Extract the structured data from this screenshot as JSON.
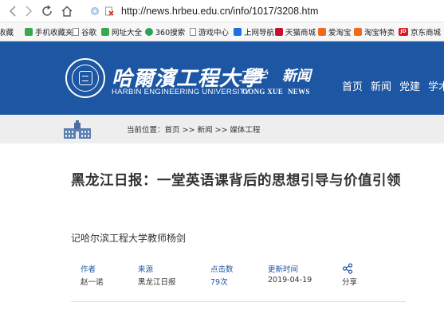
{
  "browser": {
    "url": "http://news.hrbeu.edu.cn/info/1017/3208.htm",
    "bookmarks": [
      {
        "label": "收藏",
        "icon": "none"
      },
      {
        "label": "手机收藏夹",
        "icon": "mobile-icon"
      },
      {
        "label": "谷歌",
        "icon": "page-icon"
      },
      {
        "label": "网址大全",
        "icon": "site-icon"
      },
      {
        "label": "360搜索",
        "icon": "search-360-icon"
      },
      {
        "label": "游戏中心",
        "icon": "page-icon"
      },
      {
        "label": "上网导航",
        "icon": "nav-icon"
      },
      {
        "label": "天猫商城",
        "icon": "tmall-icon"
      },
      {
        "label": "爱淘宝",
        "icon": "taobao-icon"
      },
      {
        "label": "淘宝特卖",
        "icon": "taobao-icon"
      },
      {
        "label": "京东商城",
        "icon": "jd-icon"
      }
    ]
  },
  "header": {
    "university_cn": "哈爾濱工程大學",
    "university_en": "HARBIN ENGINEERING UNIVERSITY",
    "brand_cn": "工学",
    "brand_news": "新闻",
    "brand_en_1": "GONG XUE",
    "brand_en_2": "NEWS",
    "nav": [
      "首页",
      "新闻",
      "党建",
      "学术"
    ]
  },
  "breadcrumb": {
    "label": "当前位置：",
    "path": "首页 >> 新闻 >> 媒体工程"
  },
  "article": {
    "title": "黑龙江日报：一堂英语课背后的思想引导与价值引领",
    "subtitle": "记哈尔滨工程大学教师杨剑",
    "meta": {
      "author_label": "作者",
      "author": "赵一诺",
      "source_label": "来源",
      "source": "黑龙江日报",
      "clicks_label": "点击数",
      "clicks": "79次",
      "updated_label": "更新时间",
      "updated": "2019-04-19",
      "share_label": "分享"
    }
  },
  "colors": {
    "header_bg": "#1d56a3",
    "breadcrumb_bg": "#eeeeee",
    "meta_label": "#1d56a3"
  }
}
